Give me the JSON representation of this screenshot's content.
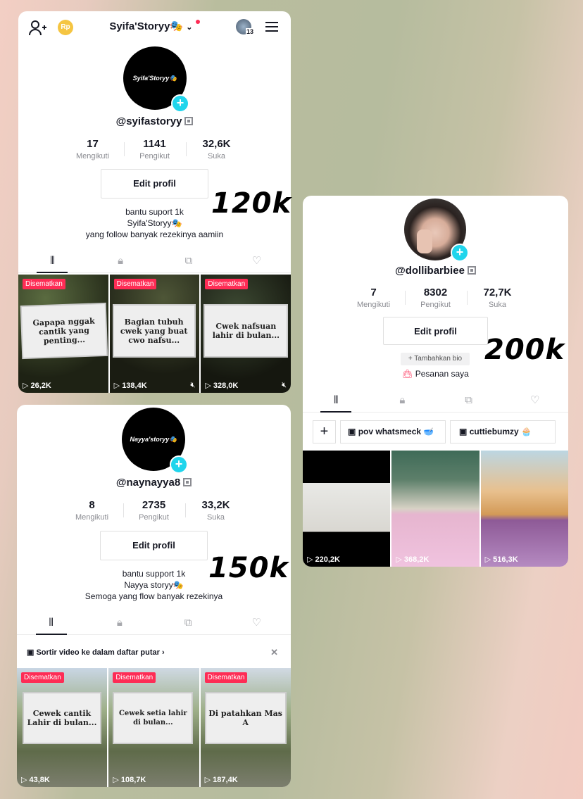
{
  "card1": {
    "username_header": "Syifa'Storyy🎭",
    "coin_label": "Rp",
    "inbox_count": "13",
    "avatar_text": "Syifa'Storyy🎭",
    "handle": "@syifastoryy",
    "stats": [
      {
        "value": "17",
        "label": "Mengikuti"
      },
      {
        "value": "1141",
        "label": "Pengikut"
      },
      {
        "value": "32,6K",
        "label": "Suka"
      }
    ],
    "edit_label": "Edit profil",
    "bio": [
      "bantu suport 1k",
      "Syifa'Storyy🎭",
      "yang follow banyak rezekinya aamiin"
    ],
    "annotation": "120k",
    "videos": [
      {
        "pin": "Disematkan",
        "sign": "Gapapa nggak cantik yang penting...",
        "views": "26,2K",
        "muted": false
      },
      {
        "pin": "Disematkan",
        "sign": "Bagian tubuh cwek yang buat cwo nafsu...",
        "views": "138,4K",
        "muted": true
      },
      {
        "pin": "Disematkan",
        "sign": "Cwek nafsuan lahir di bulan...",
        "views": "328,0K",
        "muted": true
      }
    ]
  },
  "card2": {
    "avatar_text": "Nayya'storyy🎭",
    "handle": "@naynayya8",
    "stats": [
      {
        "value": "8",
        "label": "Mengikuti"
      },
      {
        "value": "2735",
        "label": "Pengikut"
      },
      {
        "value": "33,2K",
        "label": "Suka"
      }
    ],
    "edit_label": "Edit profil",
    "bio": [
      "bantu support 1k",
      "Nayya storyy🎭",
      "Semoga yang flow banyak rezekinya"
    ],
    "annotation": "150k",
    "playlist_prompt": "Sortir video ke dalam daftar putar",
    "videos": [
      {
        "pin": "Disematkan",
        "sign": "Cewek cantik Lahir di bulan...",
        "views": "43,8K"
      },
      {
        "pin": "Disematkan",
        "sign": "Cewek setia lahir di bulan...",
        "views": "108,7K"
      },
      {
        "pin": "Disematkan",
        "sign": "Di patahkan Mas A",
        "views": "187,4K"
      }
    ]
  },
  "card3": {
    "handle": "@dollibarbiee",
    "stats": [
      {
        "value": "7",
        "label": "Mengikuti"
      },
      {
        "value": "8302",
        "label": "Pengikut"
      },
      {
        "value": "72,7K",
        "label": "Suka"
      }
    ],
    "edit_label": "Edit profil",
    "add_bio": "+ Tambahkan bio",
    "orders": "Pesanan saya",
    "annotation": "200k",
    "playlists": [
      "pov whatsmeck 🥣",
      "cuttiebumzy 🧁"
    ],
    "videos": [
      {
        "views": "220,2K"
      },
      {
        "views": "368,2K"
      },
      {
        "views": "516,3K"
      }
    ]
  }
}
